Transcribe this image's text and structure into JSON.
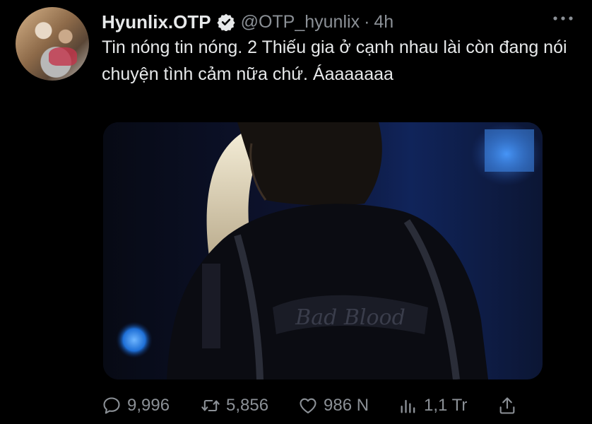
{
  "tweet": {
    "display_name": "Hyunlix.OTP",
    "handle": "@OTP_hyunlix",
    "separator": "·",
    "time": "4h",
    "text": "Tin nóng tin nóng. 2 Thiếu gia ở cạnh nhau lài còn đang nói chuyện tình cảm nữa chứ. Áaaaaaaa",
    "verified": true
  },
  "actions": {
    "replies": "9,996",
    "retweets": "5,856",
    "likes": "986 N",
    "views": "1,1 Tr"
  },
  "icons": {
    "more": "more-dots-icon",
    "reply": "reply-icon",
    "retweet": "retweet-icon",
    "like": "heart-icon",
    "views": "views-icon",
    "share": "share-icon",
    "verified": "verified-badge-icon"
  },
  "colors": {
    "background": "#000000",
    "text": "#e7e9ea",
    "secondary": "#8b9096"
  }
}
